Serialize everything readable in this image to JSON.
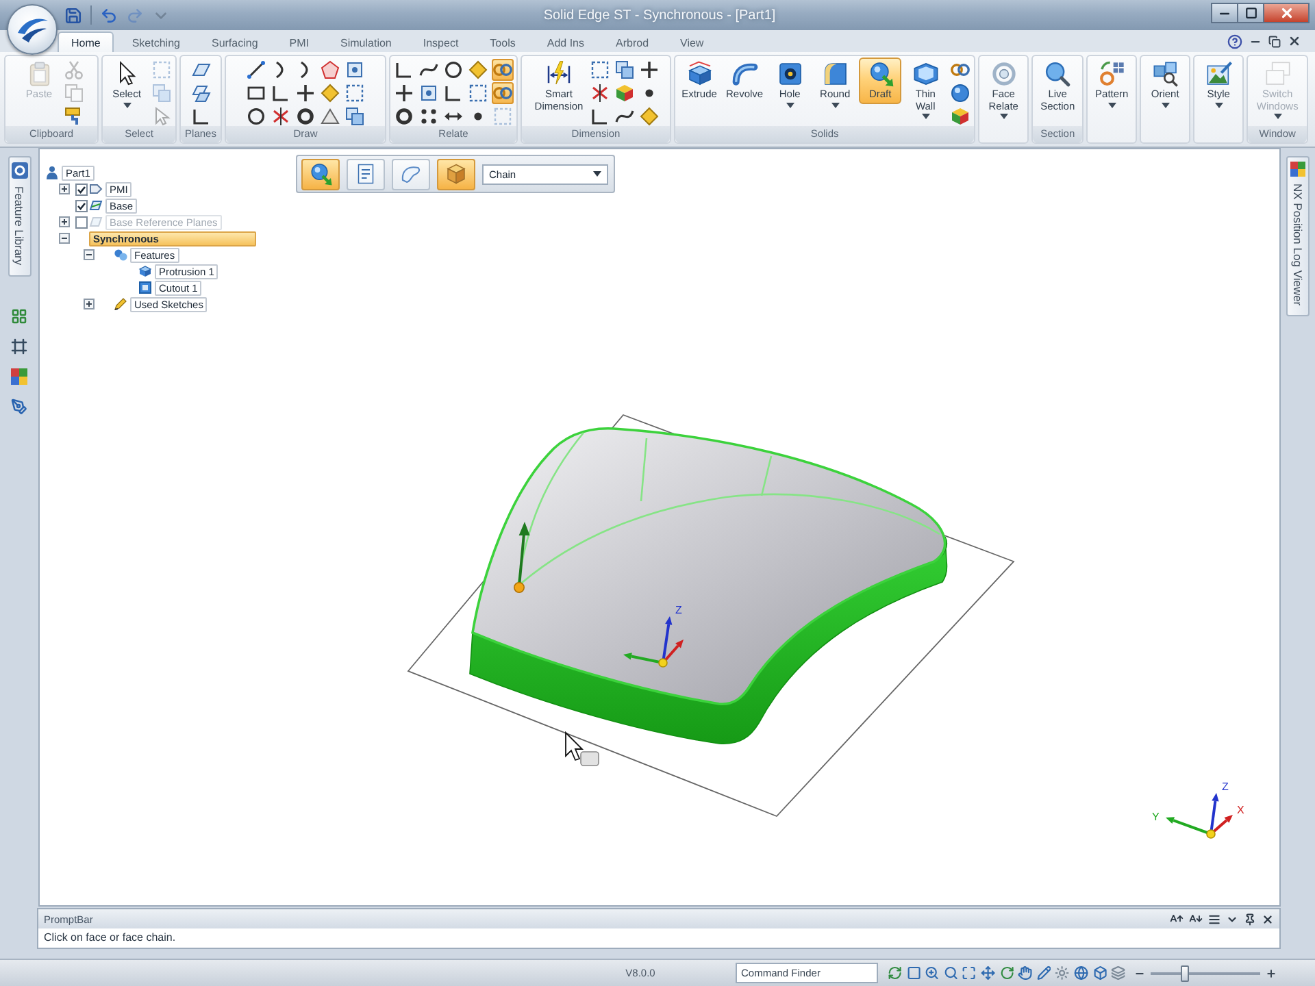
{
  "window": {
    "title": "Solid Edge ST - Synchronous - [Part1]",
    "quick_access": [
      {
        "disabled": false
      },
      {
        "disabled": false
      },
      {
        "disabled": true
      },
      {
        "disabled": true
      }
    ]
  },
  "ribbon": {
    "tabs": [
      {
        "label": "Home",
        "selected": true
      },
      {
        "label": "Sketching",
        "selected": false
      },
      {
        "label": "Surfacing",
        "selected": false
      },
      {
        "label": "PMI",
        "selected": false
      },
      {
        "label": "Simulation",
        "selected": false
      },
      {
        "label": "Inspect",
        "selected": false
      },
      {
        "label": "Tools",
        "selected": false
      },
      {
        "label": "Add Ins",
        "selected": false
      },
      {
        "label": "Arbrod",
        "selected": false
      },
      {
        "label": "View",
        "selected": false
      }
    ],
    "groups": [
      {
        "label": "Clipboard",
        "buttons": [
          {
            "label": "Paste",
            "selected": false,
            "disabled": true,
            "dropdown": false
          }
        ],
        "tools": [
          {
            "on": false,
            "disabled": true
          },
          {
            "on": false,
            "disabled": true
          },
          {
            "on": false,
            "disabled": false
          }
        ]
      },
      {
        "label": "Select",
        "buttons": [
          {
            "label": "Select",
            "selected": false,
            "disabled": false,
            "dropdown": true
          }
        ],
        "tools": [
          {
            "on": false,
            "disabled": true
          },
          {
            "on": false,
            "disabled": true
          },
          {
            "on": false,
            "disabled": true
          }
        ]
      },
      {
        "label": "Planes",
        "tools": [
          {
            "on": false,
            "disabled": false
          },
          {
            "on": false,
            "disabled": false
          },
          {
            "on": false,
            "disabled": false
          }
        ]
      },
      {
        "label": "Draw",
        "tools": [
          {
            "on": false,
            "disabled": false
          },
          {
            "on": false,
            "disabled": false
          },
          {
            "on": false,
            "disabled": false
          },
          {
            "on": false,
            "disabled": false
          },
          {
            "on": false,
            "disabled": false
          },
          {
            "on": false,
            "disabled": false
          },
          {
            "on": false,
            "disabled": false
          },
          {
            "on": false,
            "disabled": false
          },
          {
            "on": false,
            "disabled": false
          },
          {
            "on": false,
            "disabled": false
          },
          {
            "on": false,
            "disabled": false
          },
          {
            "on": false,
            "disabled": false
          },
          {
            "on": false,
            "disabled": false
          },
          {
            "on": false,
            "disabled": false
          },
          {
            "on": false,
            "disabled": false
          }
        ]
      },
      {
        "label": "Relate",
        "tools": [
          {
            "on": false,
            "disabled": false
          },
          {
            "on": false,
            "disabled": false
          },
          {
            "on": false,
            "disabled": false
          },
          {
            "on": false,
            "disabled": false
          },
          {
            "on": false,
            "disabled": false
          },
          {
            "on": false,
            "disabled": false
          },
          {
            "on": false,
            "disabled": false
          },
          {
            "on": false,
            "disabled": false
          },
          {
            "on": false,
            "disabled": false
          },
          {
            "on": false,
            "disabled": false
          },
          {
            "on": false,
            "disabled": false
          },
          {
            "on": false,
            "disabled": false
          },
          {
            "on": true,
            "disabled": false
          },
          {
            "on": true,
            "disabled": false
          },
          {
            "on": false,
            "disabled": true
          }
        ]
      },
      {
        "label": "Dimension",
        "buttons": [
          {
            "label": "Smart Dimension",
            "selected": false,
            "disabled": false,
            "dropdown": false
          }
        ],
        "tools": [
          {
            "on": false,
            "disabled": false
          },
          {
            "on": false,
            "disabled": false
          },
          {
            "on": false,
            "disabled": false
          },
          {
            "on": false,
            "disabled": false
          },
          {
            "on": false,
            "disabled": false
          },
          {
            "on": false,
            "disabled": false
          },
          {
            "on": false,
            "disabled": false
          },
          {
            "on": false,
            "disabled": false
          },
          {
            "on": false,
            "disabled": false
          }
        ]
      },
      {
        "label": "Solids",
        "buttons": [
          {
            "label": "Extrude",
            "selected": false,
            "disabled": false,
            "dropdown": false
          },
          {
            "label": "Revolve",
            "selected": false,
            "disabled": false,
            "dropdown": false
          },
          {
            "label": "Hole",
            "selected": false,
            "disabled": false,
            "dropdown": true
          },
          {
            "label": "Round",
            "selected": false,
            "disabled": false,
            "dropdown": true
          },
          {
            "label": "Draft",
            "selected": true,
            "disabled": false,
            "dropdown": false
          },
          {
            "label": "Thin Wall",
            "selected": false,
            "disabled": false,
            "dropdown": true
          }
        ],
        "tools": [
          {
            "on": false,
            "disabled": false
          },
          {
            "on": false,
            "disabled": false
          },
          {
            "on": false,
            "disabled": false
          }
        ]
      },
      {
        "buttons": [
          {
            "label": "Face Relate",
            "selected": false,
            "disabled": false,
            "dropdown": true
          }
        ]
      },
      {
        "label": "Section",
        "buttons": [
          {
            "label": "Live Section",
            "selected": false,
            "disabled": false,
            "dropdown": false
          }
        ]
      },
      {
        "buttons": [
          {
            "label": "Pattern",
            "selected": false,
            "disabled": false,
            "dropdown": true
          }
        ]
      },
      {
        "buttons": [
          {
            "label": "Orient",
            "selected": false,
            "disabled": false,
            "dropdown": true
          }
        ]
      },
      {
        "buttons": [
          {
            "label": "Style",
            "selected": false,
            "disabled": false,
            "dropdown": true
          }
        ]
      },
      {
        "label": "Window",
        "buttons": [
          {
            "label": "Switch Windows",
            "selected": false,
            "disabled": true,
            "dropdown": true
          }
        ]
      }
    ]
  },
  "left_dock": {
    "tabs": [
      {
        "label": "Feature Library"
      }
    ]
  },
  "tree": {
    "label": "Part1",
    "selected": false,
    "children": [
      {
        "label": "PMI",
        "expanded": false,
        "checked": true,
        "selected": false
      },
      {
        "label": "Base",
        "checked": true,
        "selected": false
      },
      {
        "label": "Base Reference Planes",
        "expanded": false,
        "checked": false,
        "selected": false
      },
      {
        "label": "Synchronous",
        "expanded": true,
        "selected": true,
        "children": [
          {
            "label": "Features",
            "expanded": true,
            "selected": false,
            "children": [
              {
                "label": "Protrusion 1",
                "selected": false
              },
              {
                "label": "Cutout 1",
                "selected": false
              }
            ]
          },
          {
            "label": "Used Sketches",
            "expanded": false,
            "selected": false
          }
        ]
      }
    ]
  },
  "command_bar": {
    "buttons": [
      {
        "selected": true
      },
      {
        "selected": false
      },
      {
        "selected": false
      },
      {
        "selected": true
      }
    ],
    "dropdown": {
      "value": "Chain"
    }
  },
  "model": {
    "triad": {
      "axes": [
        {
          "label": "Z",
          "color": "#2233cc"
        },
        {
          "color": "#d02020"
        },
        {
          "color": "#22aa22"
        }
      ]
    }
  },
  "view_triad": {
    "axes": [
      {
        "label": "Z",
        "color": "#2233cc"
      },
      {
        "label": "X",
        "color": "#d02020"
      },
      {
        "label": "Y",
        "color": "#22aa22"
      }
    ]
  },
  "right_dock": {
    "tabs": [
      {
        "label": "NX Position Log Viewer"
      }
    ]
  },
  "prompt_bar": {
    "title": "PromptBar",
    "message": "Click on face or face chain."
  },
  "status_bar": {
    "version": "V8.0.0",
    "command_finder": {
      "placeholder": "Command Finder"
    },
    "zoom": {
      "level": 0.3
    }
  }
}
